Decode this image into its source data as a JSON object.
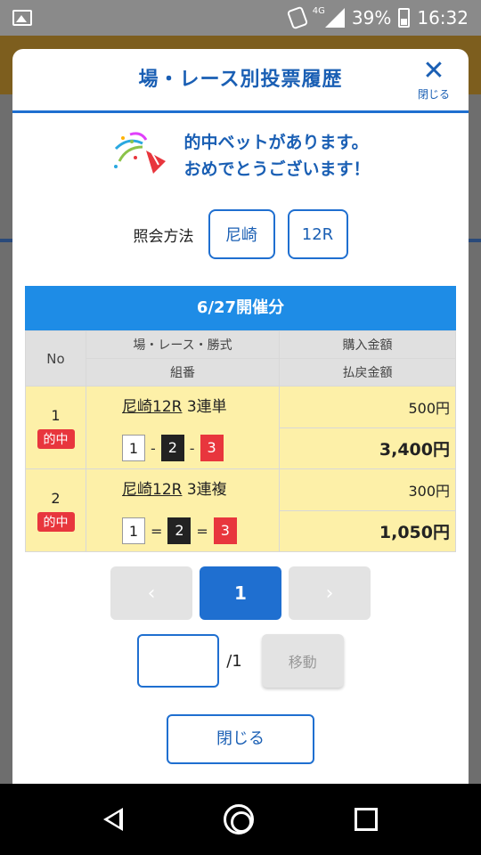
{
  "statusbar": {
    "battery": "39%",
    "time": "16:32",
    "network": "4G"
  },
  "modal": {
    "title": "場・レース別投票履歴",
    "close_label": "閉じる",
    "hit_message_line1": "的中ベットがあります。",
    "hit_message_line2": "おめでとうございます！",
    "query_label": "照会方法",
    "query_venue": "尼崎",
    "query_race": "12R"
  },
  "table": {
    "date_header": "6/27開催分",
    "headers": {
      "no": "No",
      "race_type": "場・レース・勝式",
      "purchase": "購入金額",
      "combination": "組番",
      "payout": "払戻金額"
    },
    "rows": [
      {
        "no": "1",
        "badge": "的中",
        "race": "尼崎12R",
        "type": "3連単",
        "n1": "1",
        "sep1": "-",
        "n2": "2",
        "sep2": "-",
        "n3": "3",
        "purchase": "500円",
        "payout": "3,400円"
      },
      {
        "no": "2",
        "badge": "的中",
        "race": "尼崎12R",
        "type": "3連複",
        "n1": "1",
        "sep1": "=",
        "n2": "2",
        "sep2": "=",
        "n3": "3",
        "purchase": "300円",
        "payout": "1,050円"
      }
    ]
  },
  "pager": {
    "prev": "‹",
    "current": "1",
    "next": "›"
  },
  "jump": {
    "value": "",
    "total": "/1",
    "button": "移動"
  },
  "footer": {
    "close_button": "閉じる"
  },
  "colors": {
    "accent": "#1f6fd0",
    "row_bg": "#fdf0a8",
    "hit_badge": "#e8363d",
    "date_bar": "#1e8ce6"
  }
}
